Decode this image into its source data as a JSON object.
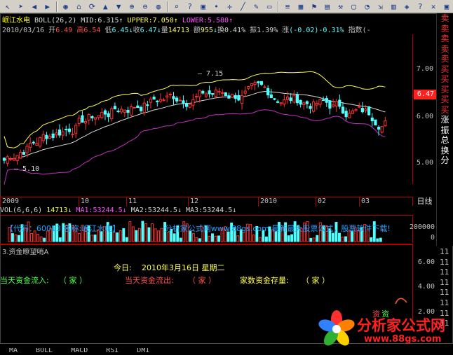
{
  "toolbar": {
    "icons": [
      "select-arrow-icon",
      "arrow-tool-icon",
      "back-icon",
      "forward-icon",
      "palette-icon",
      "home-icon",
      "refresh-icon",
      "up-icon",
      "down-icon",
      "zoom-in-icon",
      "zoom-out-icon",
      "globe-icon",
      "search-icon",
      "question-icon",
      "window-icon",
      "dot-icon",
      "crosshair-icon",
      "line-tool-icon",
      "pencil-icon",
      "ruler-icon",
      "list-icon",
      "grid-icon",
      "flag-icon",
      "chart-icon",
      "tools-icon",
      "lock-icon",
      "bell-icon",
      "export-icon",
      "print-icon",
      "network-icon",
      "help-icon",
      "exit-icon",
      "window-icon"
    ]
  },
  "header": {
    "stock_name": "岷江水电",
    "indicator": "BOLL(26,2)",
    "mid": "MID:6.315",
    "upper": "UPPER:7.050",
    "lower": "LOWER:5.580"
  },
  "quote": {
    "date": "2010/03/16",
    "open_label": "开",
    "open": "6.49",
    "high_label": "高",
    "high": "6.54",
    "low_label": "低",
    "low": "6.45",
    "close_label": "收",
    "close": "6.47",
    "volume_label": "量",
    "volume": "14713",
    "amount_label": "额",
    "amount": "955",
    "turnover_label": "换",
    "turnover": "0.41%",
    "amplitude_label": "振",
    "amplitude": "1.39%",
    "change_label": "涨",
    "change": "(-0.02)-0.31%",
    "index_label": "指数(-"
  },
  "price_axis": {
    "ticks": [
      "7.00",
      "6.00",
      "5.00"
    ],
    "current": "6.47"
  },
  "chart_annotations": {
    "high_mark": "7.15",
    "low_mark": "5.10"
  },
  "date_axis": {
    "ticks": [
      "2009",
      "10",
      "11",
      "12",
      "2010",
      "02",
      "03"
    ],
    "period": "日线"
  },
  "side_strip": {
    "chars": [
      "卖",
      "卖",
      "卖",
      "卖",
      "卖",
      "买",
      "买",
      "买",
      "买",
      "买",
      "涨",
      "振",
      "总",
      "换",
      "分"
    ]
  },
  "volume": {
    "header": "VOL(6,6,6)",
    "vol": "14713",
    "ma1": "MA1:53244.5",
    "ma2": "MA2:53244.5",
    "ma3": "MA3:53244.5",
    "axis_ticks": [
      "200000",
      "0"
    ],
    "marquee_left": "【代码：60013  名称:岷江水电】",
    "marquee_right": "分析家公式网www.88gs.com  最新最大股票公式，股票软件下载!"
  },
  "indicator_panel": {
    "title": "3.资金瞭望哨A",
    "today_label": "今日:",
    "today_value": "2010年3月16日 星期二",
    "inflow_label": "当天资金流入:",
    "inflow_value": "（ 家 ）",
    "outflow_label": "当天资金流出:",
    "outflow_value": "（ 家 ）",
    "stock_label": "家数资金存量:",
    "stock_value": "（ 家 ）",
    "axis_ticks": [
      "6.00",
      "4.00",
      "2.00"
    ],
    "marker_red": "资",
    "marker_green": "资"
  },
  "far_right": {
    "values": [
      "11",
      "11",
      "11",
      "11",
      "11",
      "11",
      "11",
      "11"
    ]
  },
  "bottom_tabs": [
    "MA",
    "BOLL",
    "MACD",
    "RSI",
    "DMI"
  ],
  "watermark": {
    "logo_text": "分析家公式网",
    "url": "www.88gs.com"
  },
  "colors": {
    "up": "#ff3030",
    "down": "#50ffff",
    "upper_band": "#ffff54",
    "mid_band": "#d8d8d8",
    "lower_band": "#c030c0",
    "axis": "#b00000",
    "brand_red": "#ff2020"
  }
}
